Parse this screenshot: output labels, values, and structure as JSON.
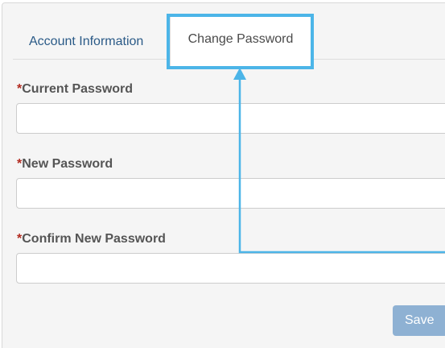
{
  "tabs": [
    {
      "label": "Account Information",
      "active": false
    },
    {
      "label": "Change Password",
      "active": true
    }
  ],
  "form": {
    "required_marker": "*",
    "fields": [
      {
        "label": "Current Password",
        "value": "",
        "placeholder": ""
      },
      {
        "label": "New Password",
        "value": "",
        "placeholder": ""
      },
      {
        "label": "Confirm New Password",
        "value": "",
        "placeholder": ""
      }
    ],
    "save_label": "Save"
  },
  "colors": {
    "highlight": "#4cb5e8",
    "required": "#b22a1f",
    "tab_link": "#2a5a87",
    "save_button": "#8eb1d3",
    "panel_background": "#f5f5f5"
  },
  "icons": [
    "arrow-up-icon"
  ]
}
